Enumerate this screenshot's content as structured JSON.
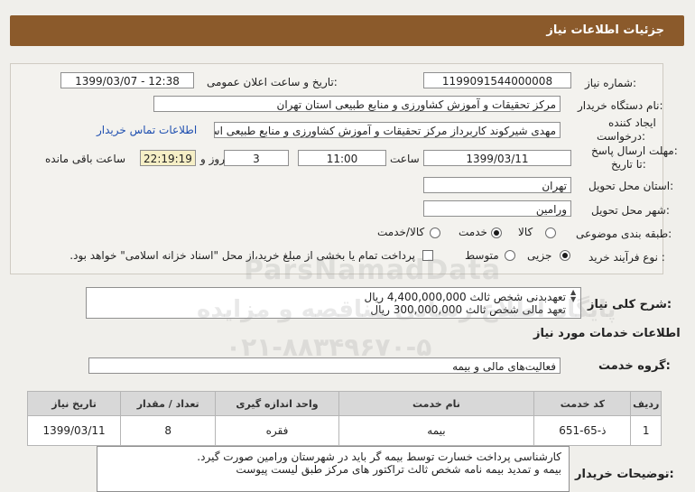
{
  "header": {
    "title": "جزئیات اطلاعات نیاز"
  },
  "fields": {
    "need_number_label": "شماره نیاز:",
    "need_number": "1199091544000008",
    "announce_label": "تاریخ و ساعت اعلان عمومی:",
    "announce_value": "1399/03/07 - 12:38",
    "buyer_label": "نام دستگاه خریدار:",
    "buyer_value": "مرکز تحقیقات و آموزش کشاورزی و منابع طبیعی استان تهران",
    "creator_label1": "ایجاد کننده",
    "creator_label2": "درخواست:",
    "creator_value": "مهدی شیرکوند کاربرداز مرکز تحقیقات و آموزش کشاورزی و منابع طبیعی استان",
    "contact_link": "اطلاعات تماس خریدار",
    "deadline_label1": "مهلت ارسال پاسخ:",
    "deadline_label2": "تا تاریخ:",
    "deadline_date": "1399/03/11",
    "time_label": "ساعت",
    "deadline_time": "11:00",
    "days_value": "3",
    "days_label": "روز و",
    "remaining_time": "22:19:19",
    "remaining_label": "ساعت باقی مانده",
    "province_label": "استان محل تحویل:",
    "province_value": "تهران",
    "city_label": "شهر محل تحویل:",
    "city_value": "ورامین",
    "category_label": "طبقه بندی موضوعی:",
    "category_options": [
      "کالا",
      "خدمت",
      "کالا/خدمت"
    ],
    "category_selected": "خدمت",
    "process_label": "نوع فرآیند خرید :",
    "process_options": [
      "جزیی",
      "متوسط"
    ],
    "process_selected": "جزیی",
    "payment_note": "پرداخت تمام یا بخشی از مبلغ خرید،از محل \"اسناد خزانه اسلامی\" خواهد بود."
  },
  "summary": {
    "label": "شرح کلی نیاز:",
    "line1": "تعهدبدنی شخص ثالث  4,400,000,000 ریال",
    "line2": "تعهد مالی شخص ثالث 300,000,000 ریال"
  },
  "services": {
    "section_title": "اطلاعات خدمات مورد نیاز",
    "group_label": "گروه خدمت:",
    "group_value": "فعالیت‌های مالی و بیمه",
    "columns": [
      "ردیف",
      "کد خدمت",
      "نام خدمت",
      "واحد اندازه گیری",
      "تعداد / مقدار",
      "تاریخ نیاز"
    ],
    "rows": [
      {
        "row": "1",
        "code": "ذ-65-651",
        "name": "بیمه",
        "unit": "فقره",
        "qty": "8",
        "date": "1399/03/11"
      }
    ]
  },
  "buyer_notes": {
    "label": "توضیحات خریدار:",
    "line1": "کارشناسی پرداخت خسارت توسط بیمه گر باید در شهرستان ورامین صورت گیرد.",
    "line2": "بیمه و تمدید بیمه نامه شخص ثالث تراکتور های مرکز طبق لیست پیوست"
  },
  "watermark": {
    "line1": "ParsNamadData",
    "line2": "پایگاه اطلاع رسانی مناقصه و مزایده",
    "line3": "۰۲۱-۸۸۳۴۹۶۷۰-۵"
  },
  "colors": {
    "header_bg": "#8b5a2b",
    "link": "#1f4fb0",
    "remaining_bg": "#f6efc6",
    "table_header": "#d8d8d8"
  }
}
